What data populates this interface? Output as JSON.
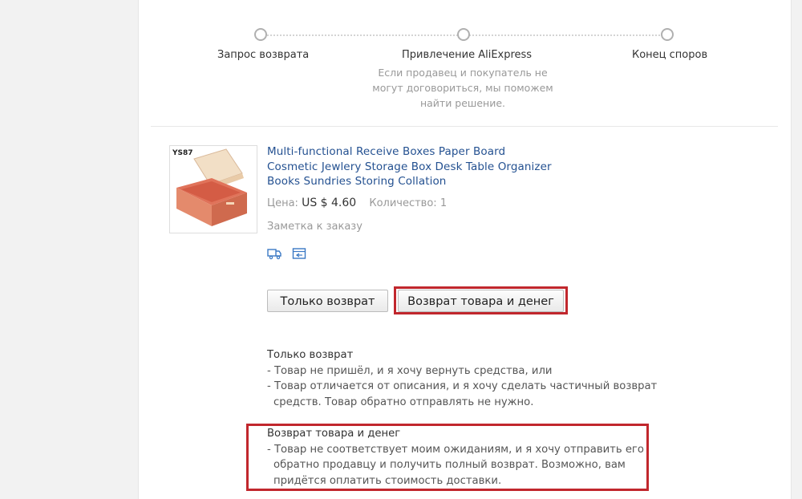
{
  "steps": [
    {
      "label": "Запрос возврата"
    },
    {
      "label": "Привлечение AliExpress",
      "description": "Если продавец и покупатель не могут договориться, мы поможем найти решение."
    },
    {
      "label": "Конец споров"
    }
  ],
  "product": {
    "title_lines": [
      "Multi-functional Receive Boxes Paper Board",
      "Cosmetic Jewlery Storage Box Desk Table Organizer",
      "Books Sundries Storing Collation"
    ],
    "image_label": "YS87",
    "price_label": "Цена:",
    "price_value": "US $ 4.60",
    "quantity_label": "Количество:",
    "quantity_value": "1",
    "order_note": "Заметка к заказу",
    "icons": [
      "shipping-icon",
      "receipt-icon"
    ]
  },
  "buttons": {
    "refund_only": "Только возврат",
    "return_and_refund": "Возврат товара и денег"
  },
  "options": [
    {
      "title": "Только возврат",
      "lines": [
        "- Товар не пришёл, и я хочу вернуть средства, или",
        "- Товар отличается от описания, и я хочу сделать частичный возврат",
        "средств. Товар обратно отправлять не нужно."
      ]
    },
    {
      "title": "Возврат товара и денег",
      "lines": [
        "- Товар не соответствует моим ожиданиям, и я хочу отправить его",
        "обратно продавцу и получить полный возврат. Возможно, вам",
        "придётся оплатить стоимость доставки."
      ]
    }
  ],
  "colors": {
    "link": "#245191",
    "highlight": "#c1272d",
    "muted": "#999999"
  }
}
